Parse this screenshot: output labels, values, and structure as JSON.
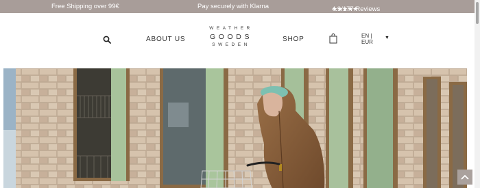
{
  "announcement": {
    "shipping": "Free Shipping over 99€",
    "payment": "Pay securely with Klarna",
    "rating_stars": "★★★★★",
    "reviews": "4.9/177 Reviews"
  },
  "header": {
    "search_icon": "search-icon",
    "nav_about": "ABOUT US",
    "logo_line1": "WEATHER",
    "logo_line2": "GOODS",
    "logo_line3": "SWEDEN",
    "nav_shop": "SHOP",
    "cart_icon": "shopping-bag-icon",
    "language": "EN |",
    "currency": "EUR",
    "locale_caret": "▼"
  },
  "hero": {
    "image": "woman-in-brown-rain-jacket-with-bicycle-in-front-of-brick-building"
  },
  "scroll_top_icon": "chevron-up-icon",
  "colors": {
    "announcement_bg": "#a89d99",
    "scroll_top_bg": "#aaa19d"
  }
}
